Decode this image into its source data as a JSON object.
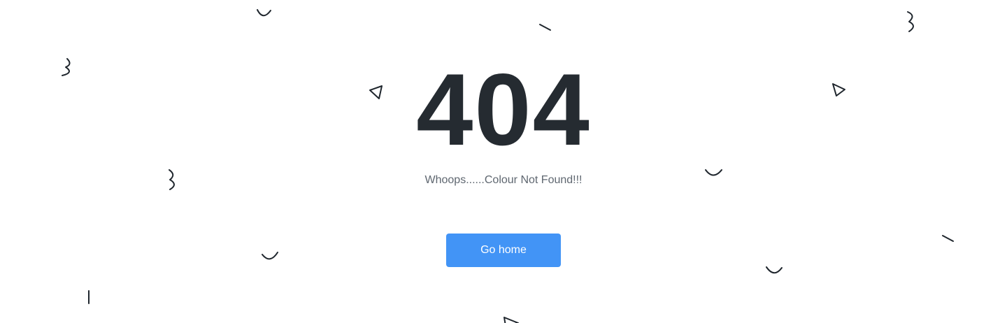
{
  "error": {
    "code": "404",
    "message": "Whoops......Colour Not Found!!!"
  },
  "actions": {
    "home_label": "Go home"
  },
  "colors": {
    "background": "#ffffff",
    "heading": "#252b31",
    "message": "#5f6770",
    "button": "#4294f6",
    "button_text": "#ffffff",
    "decor_stroke": "#1f262d"
  },
  "decorations": [
    "smile-arc",
    "dash-line",
    "squiggle-three",
    "outline-triangle",
    "vertical-tick"
  ]
}
